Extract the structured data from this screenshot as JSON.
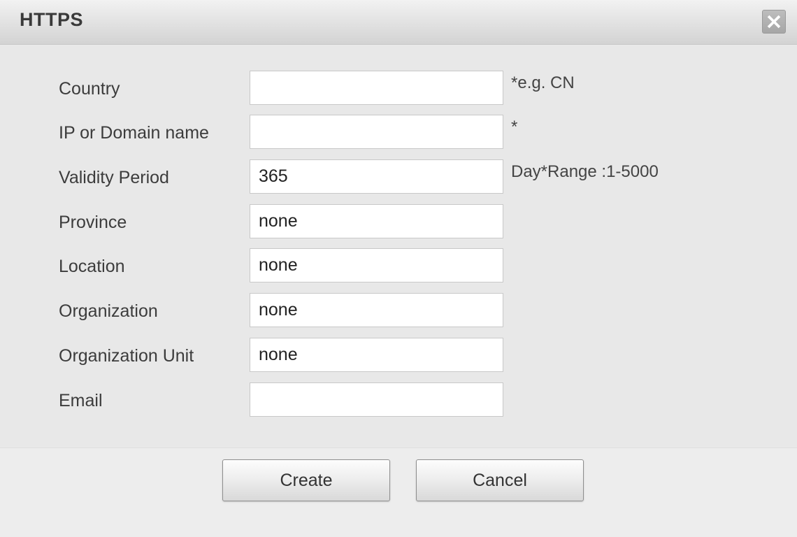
{
  "dialog": {
    "title": "HTTPS",
    "close_icon": "close-icon"
  },
  "form": {
    "fields": [
      {
        "label": "Country",
        "value": "",
        "hint": "*e.g. CN"
      },
      {
        "label": "IP or Domain name",
        "value": "",
        "hint": "*"
      },
      {
        "label": "Validity Period",
        "value": "365",
        "hint": "Day*Range :1-5000"
      },
      {
        "label": "Province",
        "value": "none",
        "hint": ""
      },
      {
        "label": "Location",
        "value": "none",
        "hint": ""
      },
      {
        "label": "Organization",
        "value": "none",
        "hint": ""
      },
      {
        "label": "Organization Unit",
        "value": "none",
        "hint": ""
      },
      {
        "label": "Email",
        "value": "",
        "hint": ""
      }
    ]
  },
  "buttons": {
    "create_label": "Create",
    "cancel_label": "Cancel"
  },
  "colors": {
    "background": "#e9e9e9",
    "close_button": "#b0b0b0"
  }
}
